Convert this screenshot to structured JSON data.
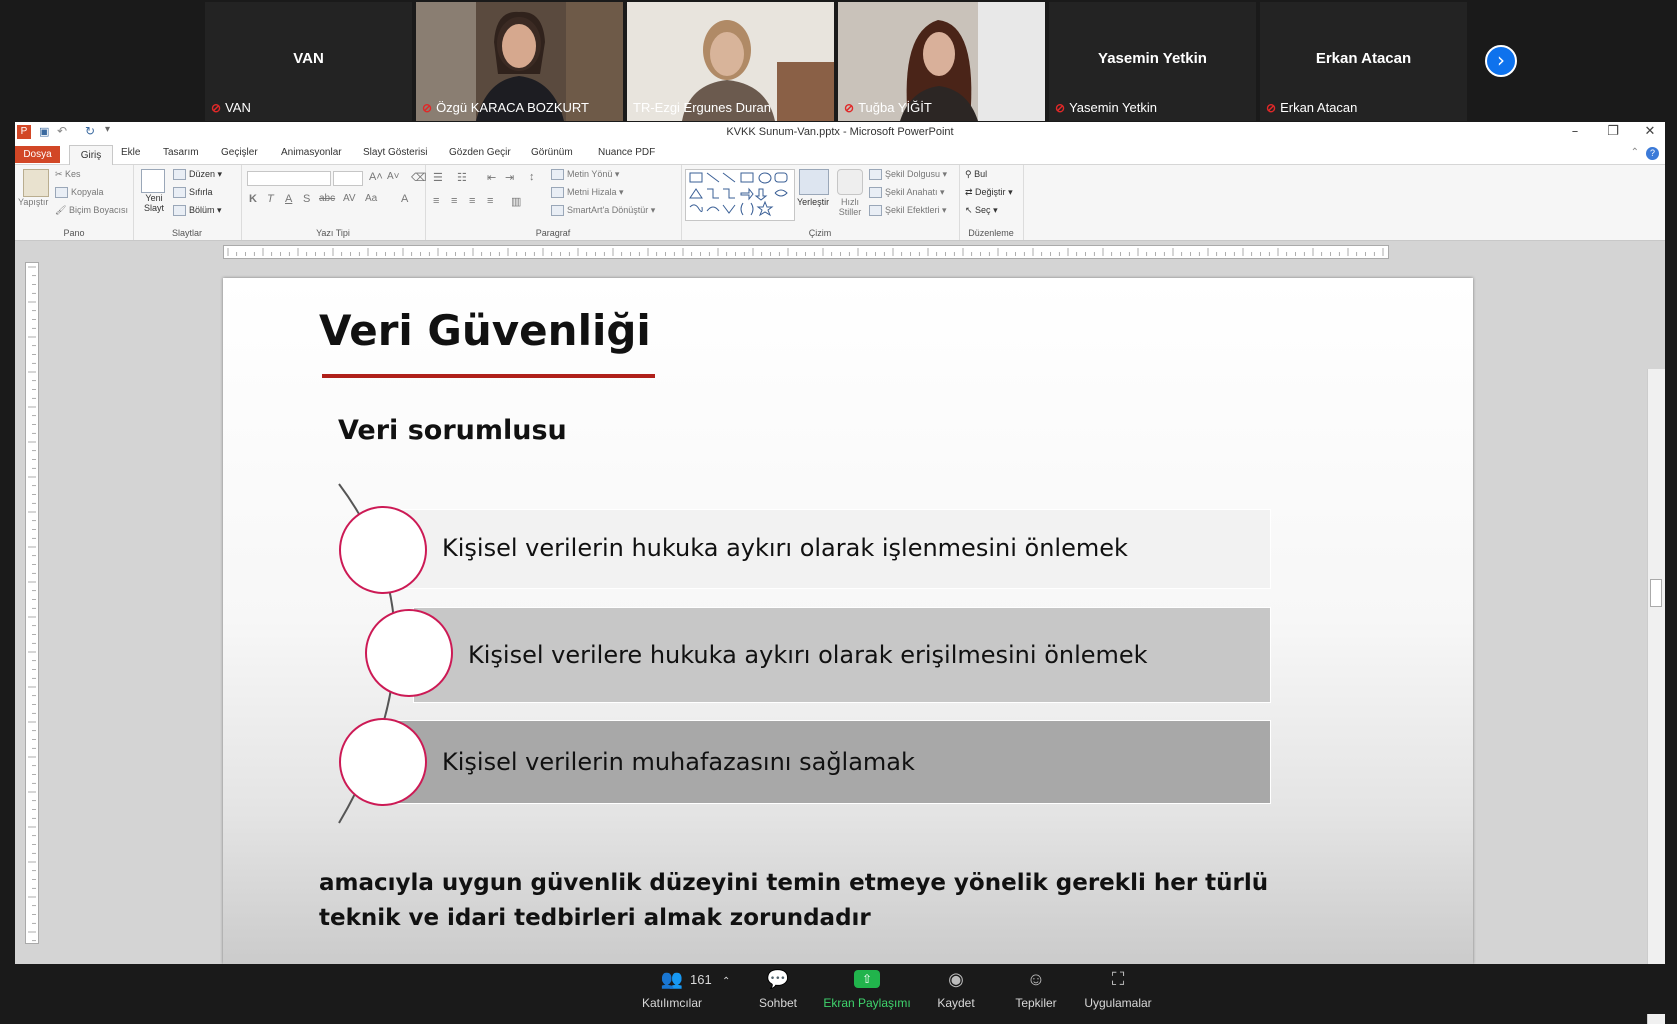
{
  "participants": [
    {
      "name": "VAN",
      "label": "VAN",
      "video": false
    },
    {
      "name": "Özgü KARACA BOZKURT",
      "label": "Özgü KARACA BOZKURT",
      "video": true
    },
    {
      "name": "TR-Ezgi Ergunes Duran",
      "label": "TR-Ezgi Ergunes Duran",
      "video": true,
      "active": true
    },
    {
      "name": "Tuğba YİĞİT",
      "label": "Tuğba YİĞİT",
      "video": true
    },
    {
      "name": "Yasemin Yetkin",
      "label": "Yasemin Yetkin",
      "video": false
    },
    {
      "name": "Erkan Atacan",
      "label": "Erkan Atacan",
      "video": false
    }
  ],
  "window": {
    "title": "KVKK Sunum-Van.pptx  -  Microsoft PowerPoint",
    "app_icon": "P"
  },
  "ribbon_tabs": [
    "Dosya",
    "Giriş",
    "Ekle",
    "Tasarım",
    "Geçişler",
    "Animasyonlar",
    "Slayt Gösterisi",
    "Gözden Geçir",
    "Görünüm",
    "Nuance PDF"
  ],
  "ribbon": {
    "pano": {
      "label": "Pano",
      "paste": "Yapıştır",
      "cut": "Kes",
      "copy": "Kopyala",
      "format_painter": "Biçim Boyacısı"
    },
    "slaytlar": {
      "label": "Slaytlar",
      "new_slide": "Yeni Slayt",
      "layout": "Düzen",
      "reset": "Sıfırla",
      "section": "Bölüm"
    },
    "yazi_tipi": {
      "label": "Yazı Tipi"
    },
    "paragraf": {
      "label": "Paragraf",
      "text_direction": "Metin Yönü",
      "align_text": "Metni Hizala",
      "smartart": "SmartArt'a Dönüştür"
    },
    "cizim": {
      "label": "Çizim",
      "arrange": "Yerleştir",
      "quick_styles": "Hızlı Stiller",
      "shape_fill": "Şekil Dolgusu",
      "shape_outline": "Şekil Anahatı",
      "shape_effects": "Şekil Efektleri"
    },
    "duzenleme": {
      "label": "Düzenleme",
      "find": "Bul",
      "replace": "Değiştir",
      "select": "Seç"
    }
  },
  "slide": {
    "title": "Veri Güvenliği",
    "subtitle": "Veri sorumlusu",
    "items": [
      {
        "text": "Kişisel verilerin hukuka aykırı olarak işlenmesini önlemek",
        "fill": "#f2f2f2"
      },
      {
        "text": "Kişisel verilere hukuka aykırı olarak erişilmesini önlemek",
        "fill": "#c7c7c7"
      },
      {
        "text": "Kişisel verilerin muhafazasını sağlamak",
        "fill": "#a8a8a8"
      }
    ],
    "closing": "amacıyla uygun güvenlik düzeyini temin etmeye yönelik gerekli her türlü teknik ve idari tedbirleri almak zorundadır",
    "colors": {
      "title_underline": "#b0201a",
      "circle_border": "#cc1a55"
    }
  },
  "toolbar": {
    "participants_count": "161",
    "participants": "Katılımcılar",
    "chat": "Sohbet",
    "share": "Ekran Paylaşımı",
    "record": "Kaydet",
    "reactions": "Tepkiler",
    "apps": "Uygulamalar"
  }
}
